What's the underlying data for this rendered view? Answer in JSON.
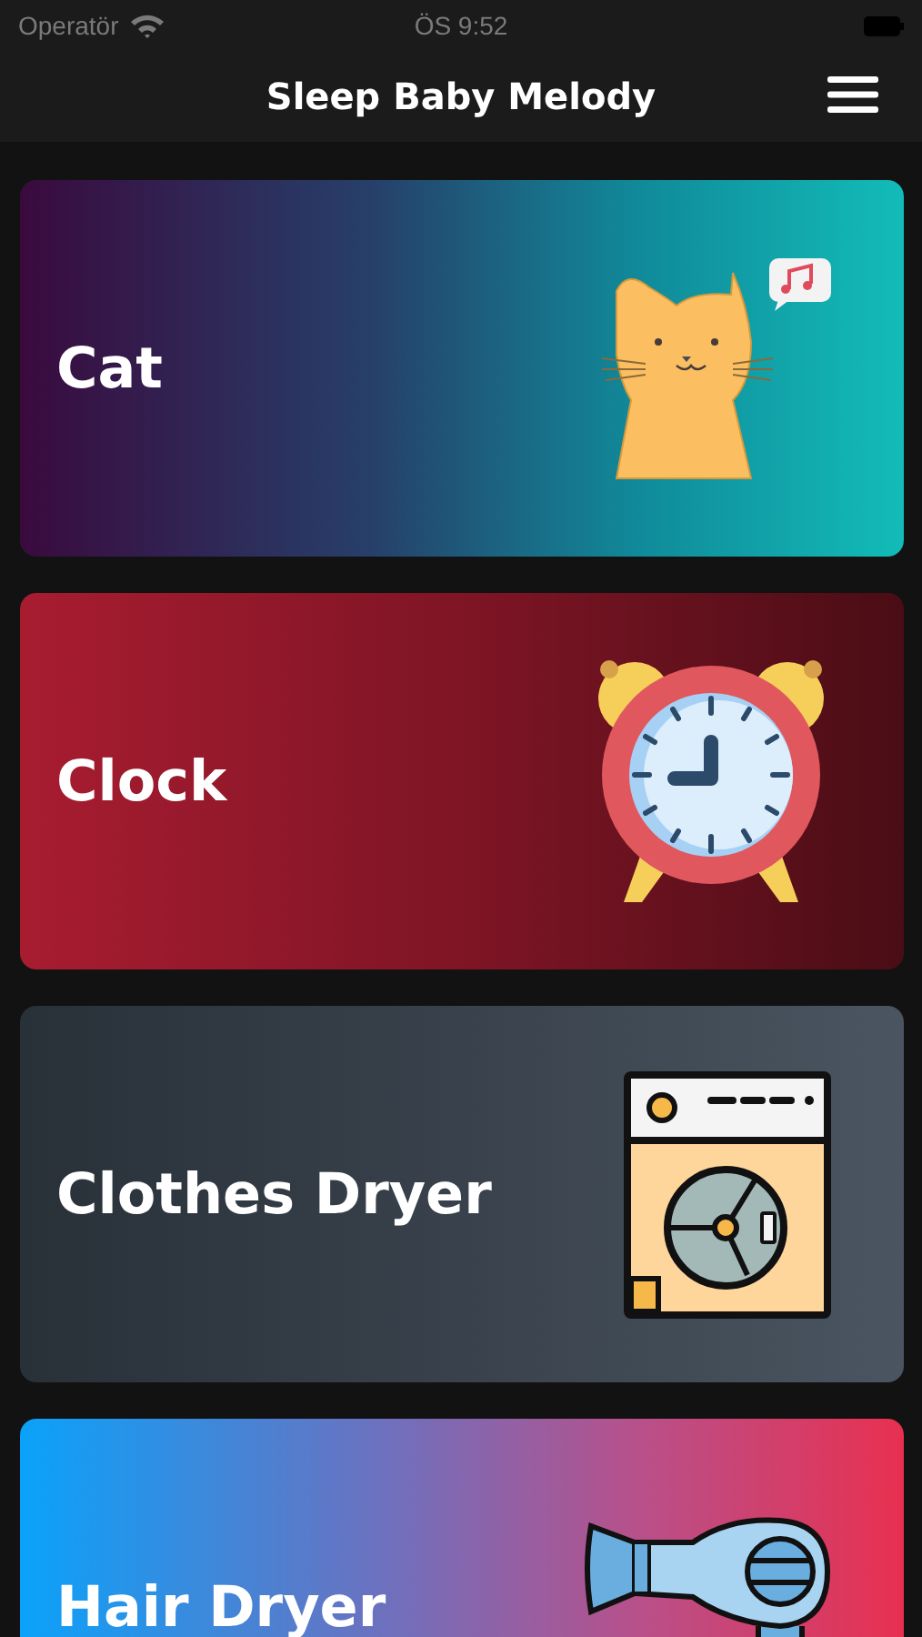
{
  "status_bar": {
    "carrier": "Operatör",
    "time": "ÖS 9:52"
  },
  "nav_bar": {
    "title": "Sleep Baby Melody"
  },
  "sounds": [
    {
      "label": "Cat",
      "kind": "cat"
    },
    {
      "label": "Clock",
      "kind": "clock"
    },
    {
      "label": "Clothes Dryer",
      "kind": "dryer"
    },
    {
      "label": "Hair Dryer",
      "kind": "hairdryer"
    }
  ]
}
